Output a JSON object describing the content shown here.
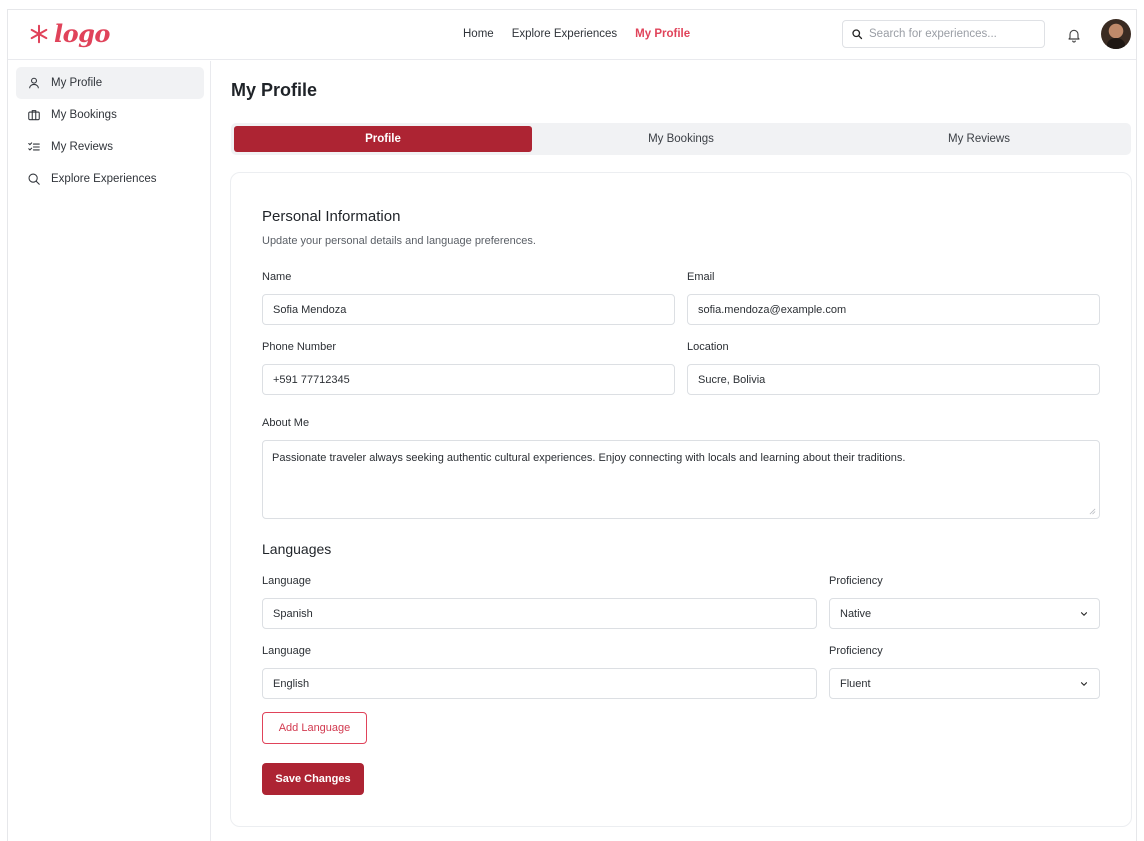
{
  "brand": {
    "logo_text": "logo",
    "accent": "#e0435a",
    "primary": "#ad2433"
  },
  "header": {
    "nav": [
      {
        "label": "Home"
      },
      {
        "label": "Explore Experiences"
      },
      {
        "label": "My Profile",
        "active": true
      }
    ],
    "search_placeholder": "Search for experiences..."
  },
  "sidebar": {
    "items": [
      {
        "label": "My Profile",
        "icon": "user-icon",
        "active": true
      },
      {
        "label": "My Bookings",
        "icon": "briefcase-icon"
      },
      {
        "label": "My Reviews",
        "icon": "checklist-icon"
      },
      {
        "label": "Explore Experiences",
        "icon": "search-icon"
      }
    ]
  },
  "page": {
    "title": "My Profile",
    "tabs": [
      {
        "label": "Profile",
        "active": true
      },
      {
        "label": "My Bookings"
      },
      {
        "label": "My Reviews"
      }
    ]
  },
  "personal": {
    "heading": "Personal Information",
    "subtitle": "Update your personal details and language preferences.",
    "name_label": "Name",
    "name_value": "Sofia Mendoza",
    "email_label": "Email",
    "email_value": "sofia.mendoza@example.com",
    "phone_label": "Phone Number",
    "phone_value": "+591 77712345",
    "location_label": "Location",
    "location_value": "Sucre, Bolivia",
    "about_label": "About Me",
    "about_value": "Passionate traveler always seeking authentic cultural experiences. Enjoy connecting with locals and learning about their traditions."
  },
  "languages": {
    "heading": "Languages",
    "rows": [
      {
        "language_label": "Language",
        "language_value": "Spanish",
        "proficiency_label": "Proficiency",
        "proficiency_value": "Native"
      },
      {
        "language_label": "Language",
        "language_value": "English",
        "proficiency_label": "Proficiency",
        "proficiency_value": "Fluent"
      }
    ],
    "add_label": "Add Language",
    "save_label": "Save Changes"
  }
}
